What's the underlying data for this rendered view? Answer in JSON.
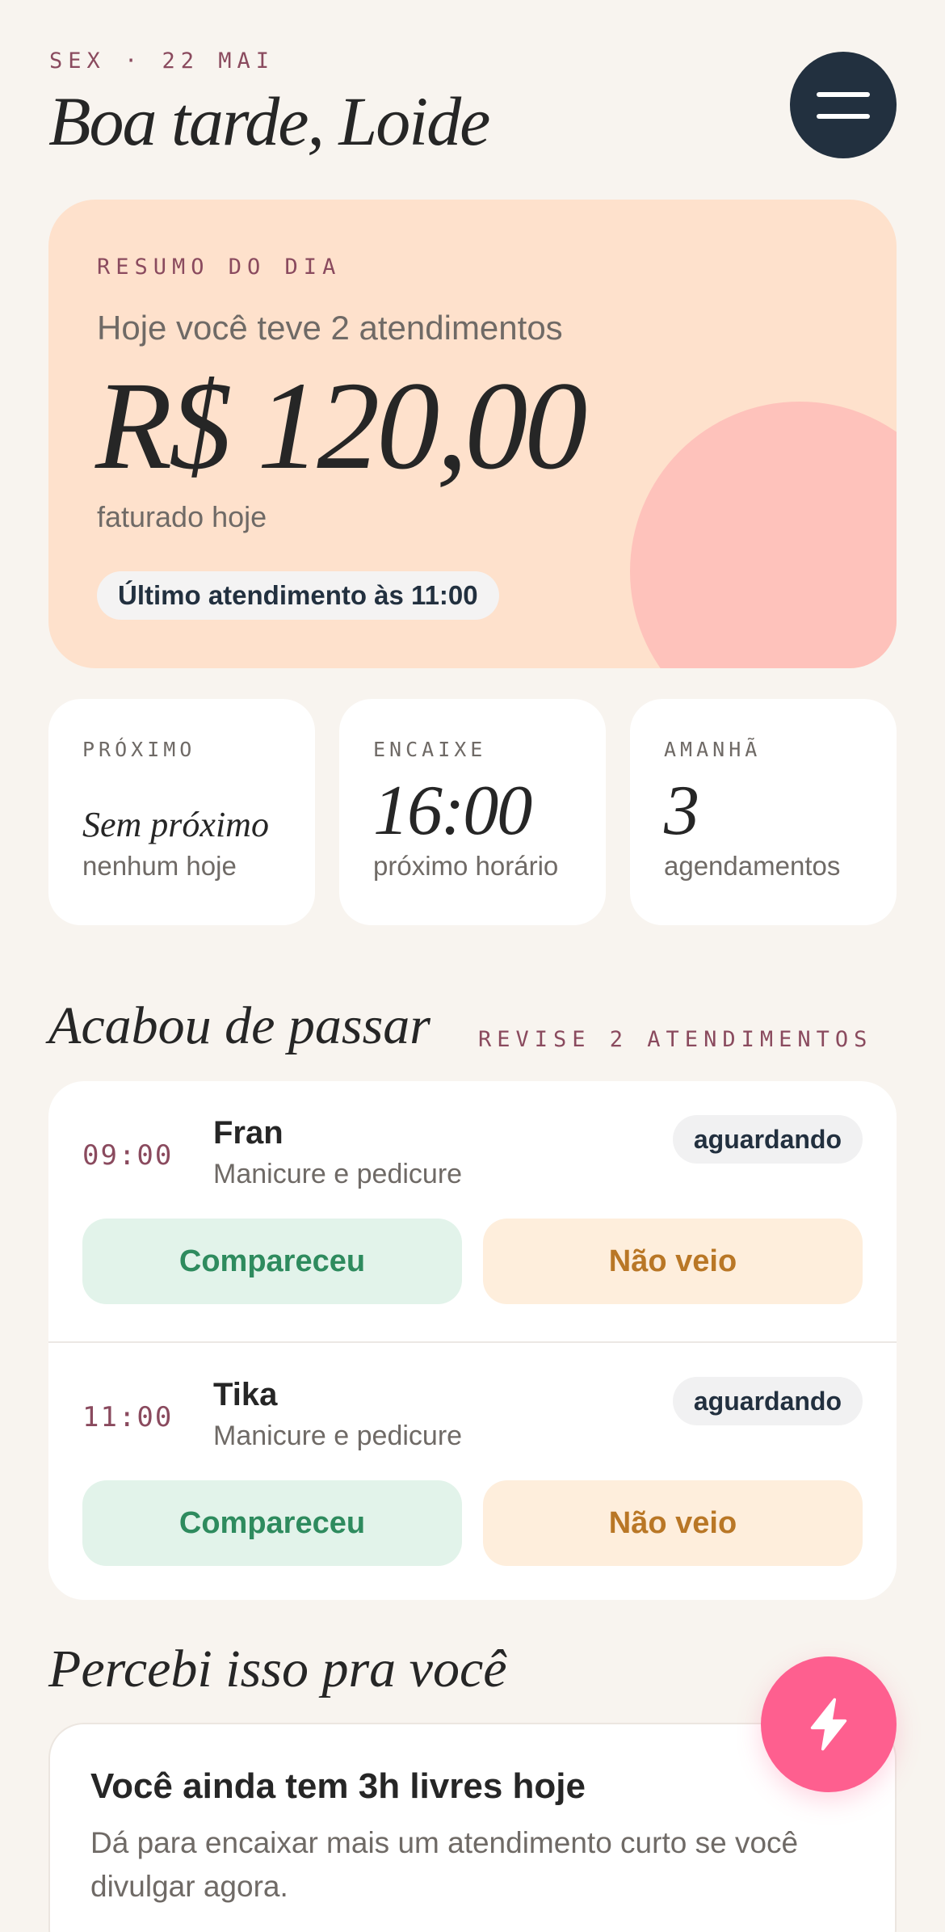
{
  "header": {
    "date": "SEX · 22 MAI",
    "greeting": "Boa tarde, Loide",
    "menu_icon": "hamburger-menu-icon"
  },
  "summary": {
    "kicker": "RESUMO DO DIA",
    "headline": "Hoje você teve 2 atendimentos",
    "amount": "R$ 120,00",
    "caption": "faturado hoje",
    "last_appointment": "Último atendimento às 11:00"
  },
  "stats": [
    {
      "kicker": "PRÓXIMO",
      "main": "Sem próximo",
      "sub": "nenhum hoje"
    },
    {
      "kicker": "ENCAIXE",
      "main": "16:00",
      "sub": "próximo horário"
    },
    {
      "kicker": "AMANHÃ",
      "main": "3",
      "sub": "agendamentos"
    }
  ],
  "recent": {
    "title": "Acabou de passar",
    "note": "REVISE 2 ATENDIMENTOS",
    "attended_label": "Compareceu",
    "no_show_label": "Não veio",
    "items": [
      {
        "time": "09:00",
        "name": "Fran",
        "service": "Manicure e pedicure",
        "status": "aguardando"
      },
      {
        "time": "11:00",
        "name": "Tika",
        "service": "Manicure e pedicure",
        "status": "aguardando"
      }
    ]
  },
  "insights": {
    "title": "Percebi isso pra você",
    "card_title": "Você ainda tem 3h livres hoje",
    "card_body": "Dá para encaixar mais um atendimento curto se você divulgar agora."
  },
  "fab": {
    "icon": "lightning-icon"
  },
  "colors": {
    "background": "#f8f4ef",
    "hero": "#fee1cc",
    "hero_blob": "#fec2bb",
    "accent": "#fe5f8f",
    "dark": "#22303f",
    "kicker": "#8a4a5e",
    "attended": "#2e8b5e",
    "no_show": "#b97726"
  }
}
